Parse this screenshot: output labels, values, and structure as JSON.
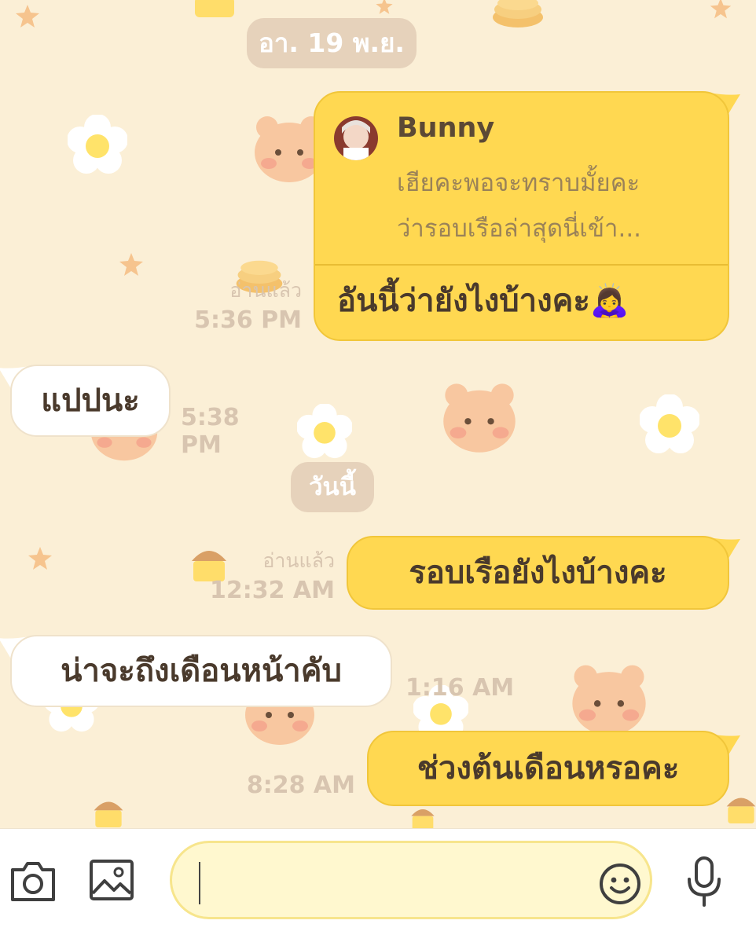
{
  "dates": {
    "previous": "อา. 19 พ.ย.",
    "today": "วันนี้"
  },
  "messages": [
    {
      "direction": "out",
      "reply": {
        "name": "Bunny",
        "preview_line1": "เฮียคะพอจะทราบมั้ยคะ",
        "preview_line2": "ว่ารอบเรือล่าสุดนี่เข้า..."
      },
      "text": "อันนี้ว่ายังไงบ้างคะ",
      "emoji": "🙇‍♀️",
      "read": "อ่านแล้ว",
      "time": "5:36 PM"
    },
    {
      "direction": "in",
      "text": "แปปนะ",
      "time": "5:38 PM"
    },
    {
      "direction": "out",
      "text": "รอบเรือยังไงบ้างคะ",
      "read": "อ่านแล้ว",
      "time": "12:32 AM"
    },
    {
      "direction": "in",
      "text": "น่าจะถึงเดือนหน้าคับ",
      "time": "1:16 AM"
    },
    {
      "direction": "out",
      "text": "ช่วงต้นเดือนหรอคะ",
      "time": "8:28 AM"
    }
  ],
  "input": {
    "value": ""
  },
  "icons": {
    "camera": "camera-icon",
    "image": "image-icon",
    "emoji": "smiley-icon",
    "mic": "microphone-icon"
  },
  "colors": {
    "background": "#fbefd6",
    "outgoing_bubble": "#ffd851",
    "incoming_bubble": "#ffffff",
    "date_chip": "#e6d2bb",
    "meta_text": "#d8c5b0"
  }
}
